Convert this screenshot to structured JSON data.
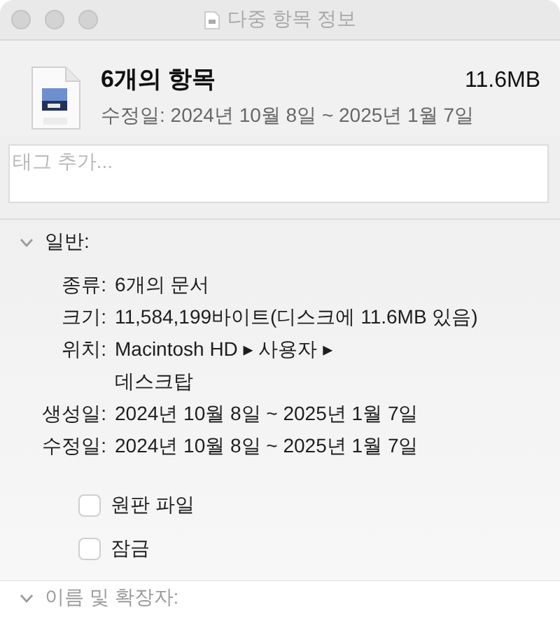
{
  "window": {
    "title": "다중 항목 정보"
  },
  "header": {
    "title": "6개의 항목",
    "size": "11.6MB",
    "modified": "수정일: 2024년 10월 8일 ~ 2025년 1월 7일"
  },
  "tags": {
    "placeholder": "태그 추가..."
  },
  "sections": [
    {
      "title": "일반:",
      "expanded": true,
      "rows": [
        {
          "label": "종류:",
          "value": "6개의 문서"
        },
        {
          "label": "크기:",
          "value": "11,584,199바이트(디스크에 11.6MB 있음)"
        },
        {
          "label": "위치:",
          "value": "Macintosh HD ▸ 사용자 ▸"
        },
        {
          "value": "데스크탑"
        },
        {
          "label": "생성일:",
          "value": "2024년 10월 8일 ~ 2025년 1월 7일"
        },
        {
          "label": "수정일:",
          "value": "2024년 10월 8일 ~ 2025년 1월 7일"
        }
      ],
      "checkboxes": [
        {
          "label": "원판 파일",
          "checked": false
        },
        {
          "label": "잠금",
          "checked": false
        }
      ]
    },
    {
      "title": "이름 및 확장자:",
      "expanded": true
    }
  ]
}
